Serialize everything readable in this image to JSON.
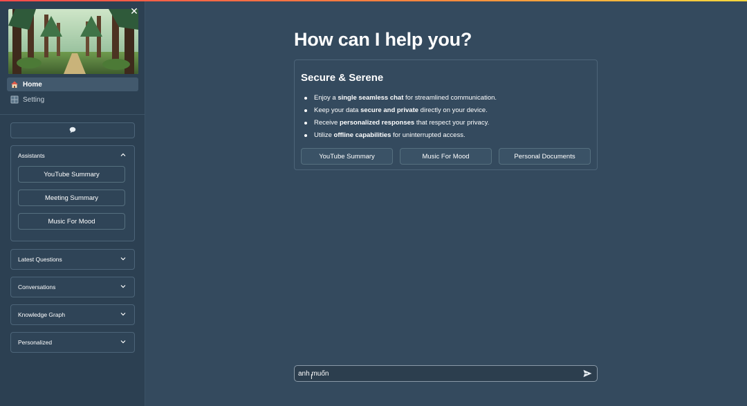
{
  "sidebar": {
    "nav": [
      {
        "label": "Home",
        "icon": "house-icon",
        "active": true
      },
      {
        "label": "Setting",
        "icon": "grid-settings-icon",
        "active": false
      }
    ],
    "chat_button_icon": "speech-balloon-icon",
    "assistants": {
      "title": "Assistants",
      "expanded": true,
      "items": [
        "YouTube Summary",
        "Meeting Summary",
        "Music For Mood"
      ]
    },
    "panels": [
      {
        "title": "Latest Questions",
        "expanded": false
      },
      {
        "title": "Conversations",
        "expanded": false
      },
      {
        "title": "Knowledge Graph",
        "expanded": false
      },
      {
        "title": "Personalized",
        "expanded": false
      }
    ]
  },
  "main": {
    "title": "How can I help you?",
    "card": {
      "title": "Secure & Serene",
      "features": [
        {
          "pre": "Enjoy a ",
          "bold": "single seamless chat",
          "post": " for streamlined communication."
        },
        {
          "pre": "Keep your data ",
          "bold": "secure and private",
          "post": " directly on your device."
        },
        {
          "pre": "Receive ",
          "bold": "personalized responses",
          "post": " that respect your privacy."
        },
        {
          "pre": "Utilize ",
          "bold": "offline capabilities",
          "post": " for uninterrupted access."
        }
      ],
      "buttons": [
        "YouTube Summary",
        "Music For Mood",
        "Personal Documents"
      ]
    },
    "chat_input": {
      "value": "anh muốn"
    }
  },
  "colors": {
    "background": "#344a5e",
    "sidebar": "#2c4052",
    "border": "#4d6579",
    "accent_bar_start": "#ff4b4b",
    "accent_bar_end": "#ffd93d"
  }
}
